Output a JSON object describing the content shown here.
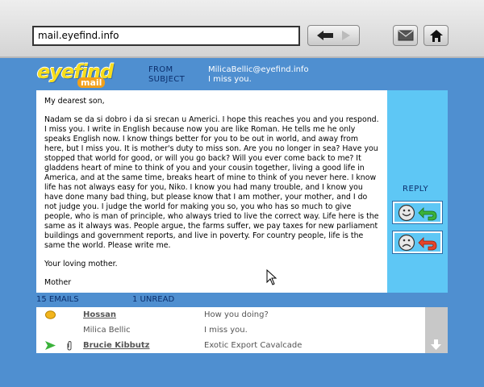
{
  "browser": {
    "url": "mail.eyefind.info"
  },
  "logo": {
    "main": "eyefind",
    "sub": "mail"
  },
  "header": {
    "from_label": "FROM",
    "subject_label": "SUBJECT",
    "from_value": "MilicaBellic@eyefind.info",
    "subject_value": "I miss you."
  },
  "message": {
    "greeting": "My dearest son,",
    "body": "Nadam se da si dobro i da si srecan u Americi. I hope this reaches you and you respond. I miss you. I write in English because now you are like Roman. He tells me he only speaks English now. I know things better for you to be out in world, and away from here, but I miss you. It is mother's duty to miss son. Are you no longer in sea? Have you stopped that world for good, or will you go back? Will you ever come back to me? It gladdens heart of mine to think of you and your cousin together, living a good life in America, and at the same time, breaks heart of mine to think of you never here. I know life has not always easy for you, Niko. I know you had many trouble, and I know you have done many bad thing, but please know that I am mother, your mother, and I do not judge you. I judge the world for making you so, you who has so much to give people, who is man of principle, who always tried to live the correct way. Life here is the same as it always was. People argue, the farms suffer, we pay taxes for new parliament buildings and government reports, and live in poverty. For country people, life is the same the world. Please write me.",
    "closing": "Your loving mother.",
    "signature": "Mother"
  },
  "side": {
    "reply_label": "REPLY"
  },
  "inbox": {
    "count_label": "15 EMAILS",
    "unread_label": "1 UNREAD",
    "rows": [
      {
        "sender": "Hossan",
        "subject": "How you doing?",
        "unread": true,
        "icon": "unread-dot-icon"
      },
      {
        "sender": "Milica Bellic",
        "subject": "I miss you.",
        "unread": false,
        "icon": ""
      },
      {
        "sender": "Brucie Kibbutz",
        "subject": "Exotic Export Cavalcade",
        "unread": true,
        "icon": "replied-arrow-icon"
      }
    ]
  },
  "colors": {
    "background": "#4f8fd0",
    "side_panel": "#5ec7f5",
    "label_navy": "#0b2e6c",
    "logo_yellow": "#f7dd1c"
  }
}
